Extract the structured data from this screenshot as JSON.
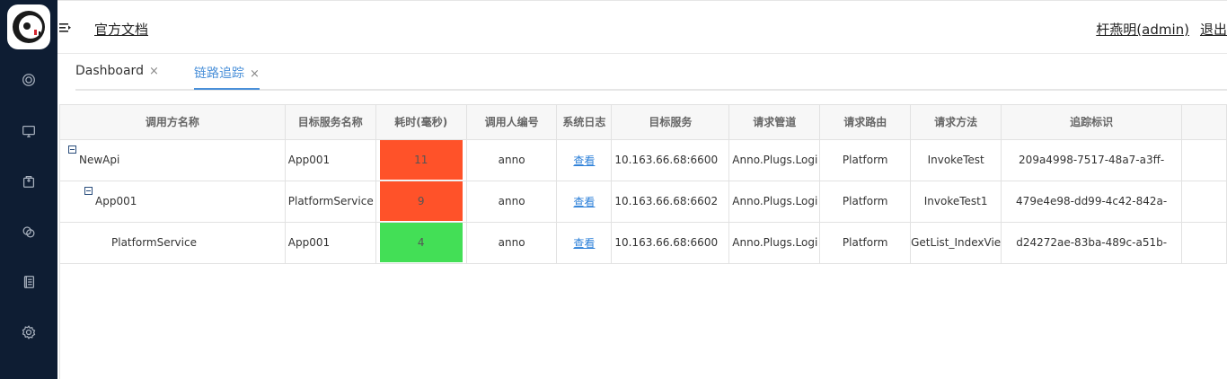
{
  "topbar": {
    "docs_link": "官方文档",
    "user": "杆燕明(admin)",
    "logout": "退出"
  },
  "tabs": [
    {
      "label": "Dashboard",
      "close": "×"
    },
    {
      "label": "链路追踪",
      "close": "×"
    }
  ],
  "sidebar": {
    "icons": [
      "target-icon",
      "monitor-icon",
      "package-icon",
      "link-icon",
      "book-icon",
      "settings-icon"
    ]
  },
  "colors": {
    "slow": "#ff5229",
    "fast": "#43df56",
    "accent": "#4a90d9",
    "sidebar": "#0e1d33"
  },
  "table": {
    "columns": [
      "调用方名称",
      "目标服务名称",
      "耗时(毫秒)",
      "调用人编号",
      "系统日志",
      "目标服务",
      "请求管道",
      "请求路由",
      "请求方法",
      "追踪标识"
    ],
    "rows": [
      {
        "caller": "NewApi",
        "target_name": "App001",
        "cost": "11",
        "cost_level": "slow",
        "user_no": "anno",
        "log": "查看",
        "target": "10.163.66.68:6600",
        "pipe": "Anno.Plugs.Logi",
        "route": "Platform",
        "method": "InvokeTest",
        "trace": "209a4998-7517-48a7-a3ff-"
      },
      {
        "caller": "App001",
        "target_name": "PlatformService",
        "cost": "9",
        "cost_level": "slow",
        "user_no": "anno",
        "log": "查看",
        "target": "10.163.66.68:6602",
        "pipe": "Anno.Plugs.Logi",
        "route": "Platform",
        "method": "InvokeTest1",
        "trace": "479e4e98-dd99-4c42-842a-"
      },
      {
        "caller": "PlatformService",
        "target_name": "App001",
        "cost": "4",
        "cost_level": "fast",
        "user_no": "anno",
        "log": "查看",
        "target": "10.163.66.68:6600",
        "pipe": "Anno.Plugs.Logi",
        "route": "Platform",
        "method": "GetList_IndexVie",
        "trace": "d24272ae-83ba-489c-a51b-"
      }
    ]
  }
}
